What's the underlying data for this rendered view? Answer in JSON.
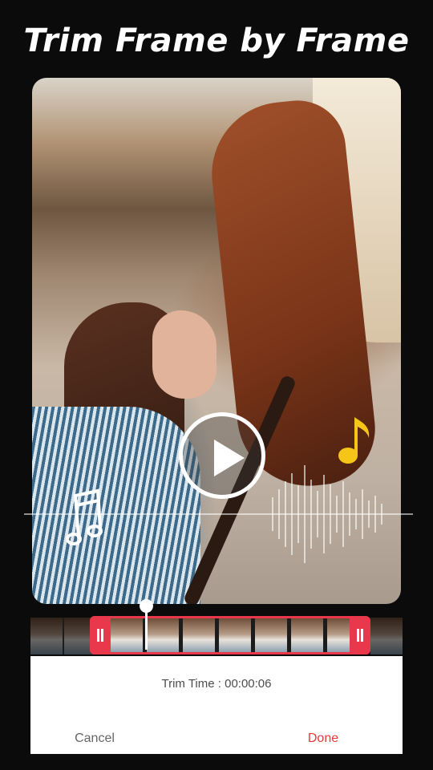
{
  "headline": "Trim Frame by Frame",
  "trim": {
    "label": "Trim Time : 00:00:06",
    "cancel_label": "Cancel",
    "done_label": "Done"
  },
  "icons": {
    "play": "play-icon",
    "music_note_yellow": "music-note-icon",
    "music_note_white": "music-notes-icon"
  },
  "colors": {
    "accent": "#e9374b",
    "done": "#e23b3b",
    "note_yellow": "#f5c518"
  }
}
